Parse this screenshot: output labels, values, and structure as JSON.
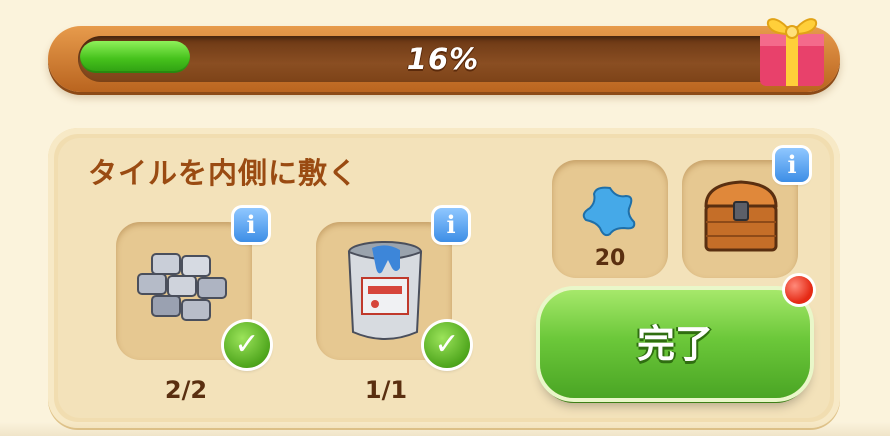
{
  "progress": {
    "percent_label": "16%",
    "fraction": 0.16,
    "gift_icon": "gift-box-icon"
  },
  "task": {
    "title": "タイルを内側に敷く",
    "requirements": [
      {
        "icon": "stone-tiles-icon",
        "count": "2/2",
        "completed": true,
        "info_label": "i"
      },
      {
        "icon": "paint-bucket-icon",
        "count": "1/1",
        "completed": true,
        "info_label": "i"
      }
    ],
    "rewards": [
      {
        "icon": "blue-star-icon",
        "count": "20"
      },
      {
        "icon": "treasure-chest-icon",
        "info_label": "i"
      }
    ],
    "done_button_label": "完了",
    "notification_dot_color": "#e52a15"
  },
  "colors": {
    "accent_green": "#6cc83a",
    "title_brown": "#9a4b12",
    "frame_orange": "#d9823a"
  }
}
